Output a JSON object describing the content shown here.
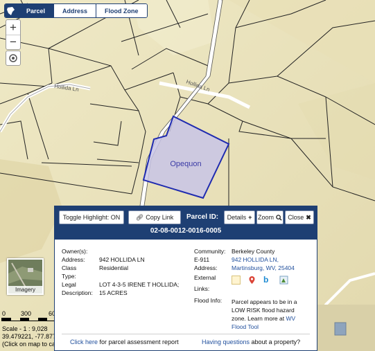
{
  "tabs": [
    {
      "label": "Parcel",
      "active": true
    },
    {
      "label": "Address",
      "active": false
    },
    {
      "label": "Flood Zone",
      "active": false
    }
  ],
  "map": {
    "road_labels": [
      "Hollida Ln",
      "Hollida Ln"
    ],
    "parcel_label": "Opequon",
    "highlight_color": "#1f2bb0",
    "highlight_fill": "#c8c4e6"
  },
  "zoom": {
    "in_label": "+",
    "out_label": "−"
  },
  "imagery": {
    "label": "Imagery"
  },
  "scale": {
    "ticks": [
      "0",
      "300",
      "60"
    ],
    "scale_text": "Scale - 1 : 9,028",
    "coords_text": "39.479221, -77.8779",
    "hint_text": "(Click on map to ca"
  },
  "popup": {
    "toggle_label": "Toggle Highlight: ON",
    "copy_label": "Copy Link",
    "parcel_id_label": "Parcel ID:",
    "parcel_id": "02-08-0012-0016-0005",
    "details_label": "Details",
    "zoom_label": "Zoom",
    "close_label": "Close",
    "left": {
      "owner_label": "Owner(s):",
      "address_label": "Address:",
      "address_value": "942 HOLLIDA LN",
      "class_label": "Class",
      "class_value": "Residential",
      "type_label": "Type:",
      "legal_label": "Legal",
      "legal_value_1": "LOT 4-3-5 IRENE T HOLLIDA;",
      "description_label": "Description:",
      "legal_value_2": "15 ACRES"
    },
    "right": {
      "community_label": "Community:",
      "community_value": "Berkeley County",
      "e911_label": "E-911",
      "e911_value_1": "942 HOLLIDA LN,",
      "address_label": "Address:",
      "e911_value_2": "Martinsburg, WV, 25404",
      "external_label": "External",
      "links_label": "Links:",
      "flood_label": "Flood Info:",
      "flood_text_1": "Parcel appears to be in a",
      "flood_text_2": "LOW RISK flood hazard",
      "flood_text_3": "zone. Learn more at ",
      "flood_link_1": "WV",
      "flood_link_2": "Flood Tool"
    },
    "footer": {
      "left_link": "Click here",
      "left_text": " for parcel assessment report",
      "right_link": "Having questions",
      "right_text": " about a property?"
    }
  }
}
